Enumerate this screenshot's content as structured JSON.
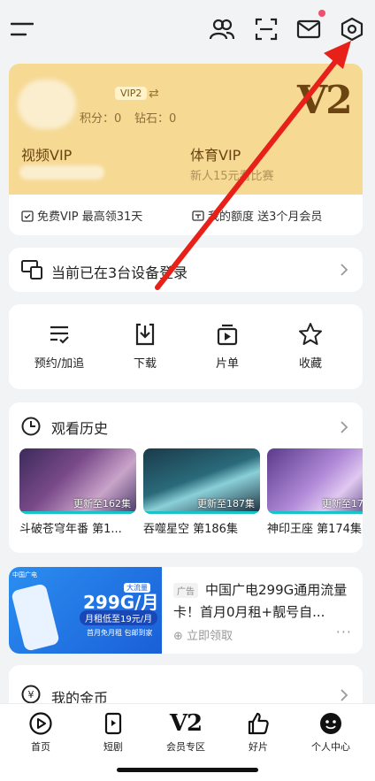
{
  "topbar": {
    "icons": [
      "menu-icon",
      "friends-icon",
      "scan-icon",
      "mail-icon",
      "settings-icon"
    ]
  },
  "vip": {
    "badge": "VIP2",
    "points_label": "积分：0",
    "diamonds_label": "钻石：0",
    "level_mark": "V2",
    "video_vip": "视频VIP",
    "sport_vip": "体育VIP",
    "sport_sub": "新人15元看比赛",
    "free_vip": "免费VIP 最高领31天",
    "quota": "我的额度 送3个月会员"
  },
  "device": {
    "text": "当前已在3台设备登录"
  },
  "actions": [
    {
      "label": "预约/加追",
      "icon": "reservation-icon"
    },
    {
      "label": "下载",
      "icon": "download-icon"
    },
    {
      "label": "片单",
      "icon": "playlist-icon"
    },
    {
      "label": "收藏",
      "icon": "star-icon"
    }
  ],
  "history": {
    "title": "观看历史",
    "items": [
      {
        "update": "更新至162集",
        "title": "斗破苍穹年番 第1..."
      },
      {
        "update": "更新至187集",
        "title": "吞噬星空 第186集"
      },
      {
        "update": "更新至17",
        "title": "神印王座 第174集"
      }
    ]
  },
  "ad": {
    "tag": "广告",
    "title": "中国广电299G通用流量卡！首月0月租+靓号自...",
    "action": "立即领取",
    "more": "···",
    "image": {
      "logo": "中国广电",
      "price": "299G/月",
      "price_tag": "大流量",
      "sub": "月租低至19元/月",
      "small": "首月免月租 包邮到家"
    }
  },
  "coins": {
    "title": "我的金币"
  },
  "bottom_nav": [
    {
      "label": "首页",
      "icon": "home-play-icon"
    },
    {
      "label": "短剧",
      "icon": "short-drama-icon"
    },
    {
      "label": "会员专区",
      "icon": "v2-icon",
      "mark": "V2"
    },
    {
      "label": "好片",
      "icon": "thumbs-up-icon"
    },
    {
      "label": "个人中心",
      "icon": "profile-icon"
    }
  ],
  "colors": {
    "vip_gold": "#f6d993",
    "vip_brown": "#6b4412",
    "progress_teal": "#19c4c9",
    "annotation_red": "#e8201a",
    "notification_dot": "#f0506e"
  }
}
